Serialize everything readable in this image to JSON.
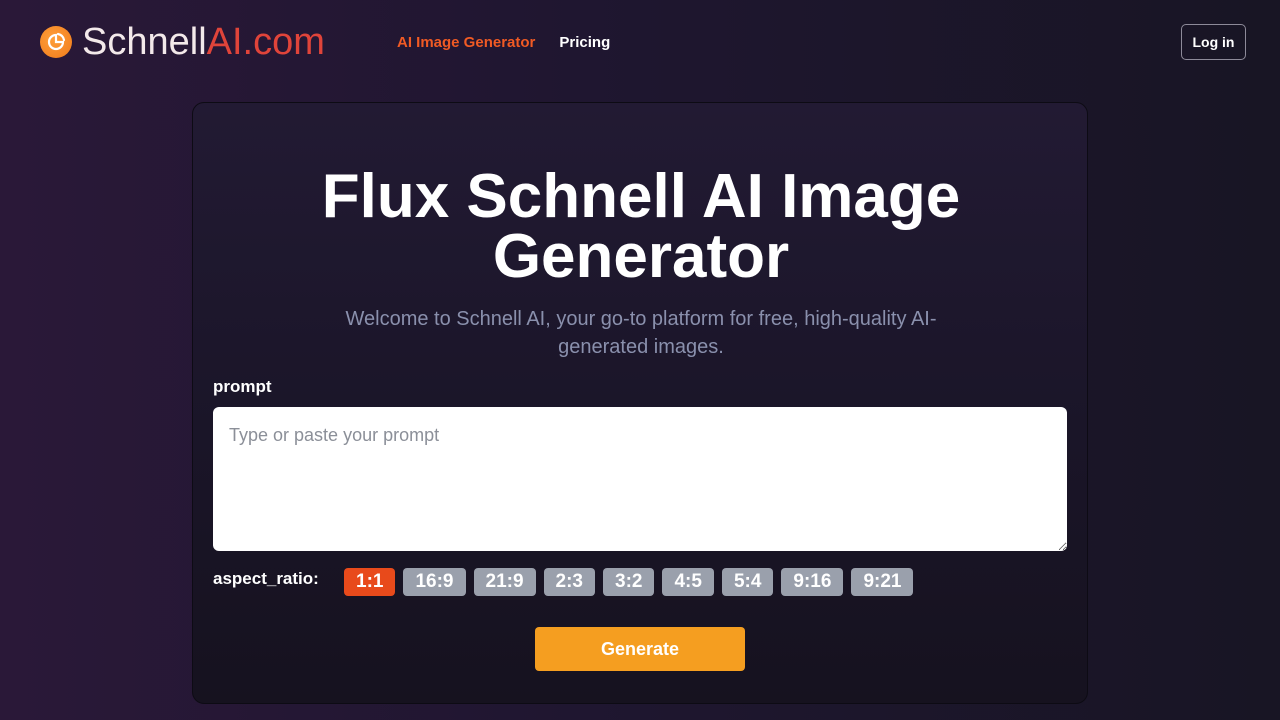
{
  "header": {
    "logo": {
      "text_part1": "Schnell",
      "text_part2": "AI.com",
      "icon": "logo-badge-icon"
    },
    "nav": [
      {
        "label": "AI Image Generator",
        "active": true
      },
      {
        "label": "Pricing",
        "active": false
      }
    ],
    "login_label": "Log in"
  },
  "main": {
    "title": "Flux Schnell AI Image Generator",
    "subtitle": "Welcome to Schnell AI, your go-to platform for free, high-quality AI-generated images.",
    "prompt": {
      "label": "prompt",
      "placeholder": "Type or paste your prompt",
      "value": ""
    },
    "aspect_ratio": {
      "label": "aspect_ratio:",
      "options": [
        "1:1",
        "16:9",
        "21:9",
        "2:3",
        "3:2",
        "4:5",
        "5:4",
        "9:16",
        "9:21"
      ],
      "selected": "1:1"
    },
    "generate_label": "Generate"
  },
  "colors": {
    "accent": "#f05a24",
    "selected_ratio": "#e84a1b",
    "generate": "#f59e20",
    "logo_red": "#e0443a"
  }
}
